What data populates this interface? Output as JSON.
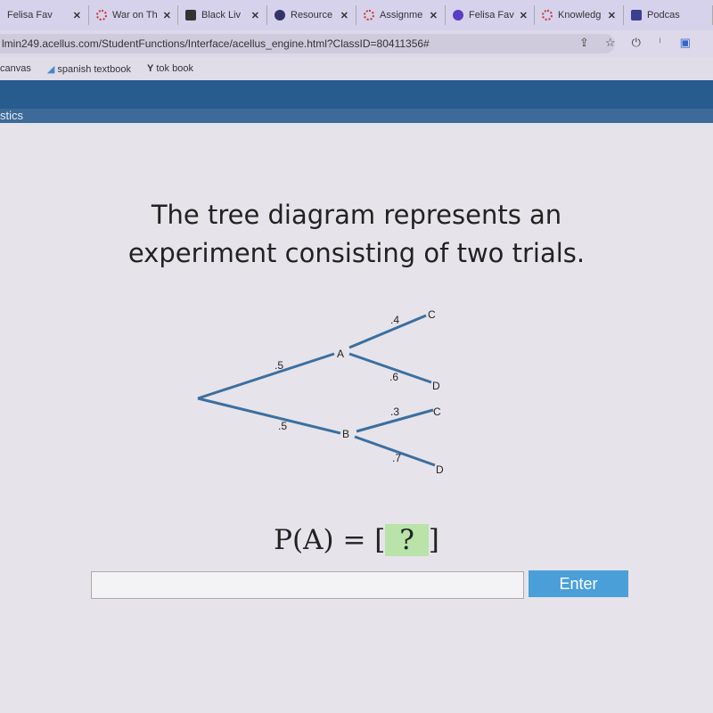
{
  "browser": {
    "tabs": [
      {
        "label": "Felisa Fav",
        "icon": "none"
      },
      {
        "label": "War on Th",
        "icon": "canvas-icon"
      },
      {
        "label": "Black Liv",
        "icon": "wp-icon"
      },
      {
        "label": "Resource",
        "icon": "globe-icon"
      },
      {
        "label": "Assignme",
        "icon": "canvas-icon"
      },
      {
        "label": "Felisa Fav",
        "icon": "k-icon"
      },
      {
        "label": "Knowledg",
        "icon": "canvas-icon"
      },
      {
        "label": "Podcas",
        "icon": "doc-icon"
      }
    ],
    "url": "lmin249.acellus.com/StudentFunctions/Interface/acellus_engine.html?ClassID=80411356#",
    "bookmarks": [
      "canvas",
      "spanish textbook",
      "tok book"
    ]
  },
  "course": "stics",
  "question": {
    "line1": "The tree diagram represents an",
    "line2": "experiment consisting of two trials."
  },
  "tree": {
    "first": [
      {
        "node": "A",
        "p": ".5",
        "branches": [
          {
            "node": "C",
            "p": ".4"
          },
          {
            "node": "D",
            "p": ".6"
          }
        ]
      },
      {
        "node": "B",
        "p": ".5",
        "branches": [
          {
            "node": "C",
            "p": ".3"
          },
          {
            "node": "D",
            "p": ".7"
          }
        ]
      }
    ],
    "line_color": "#3b6fa0"
  },
  "prompt": {
    "lhs": "P(A) = [",
    "blank": " ? ",
    "rhs": "]"
  },
  "answer": {
    "value": "",
    "button": "Enter"
  }
}
